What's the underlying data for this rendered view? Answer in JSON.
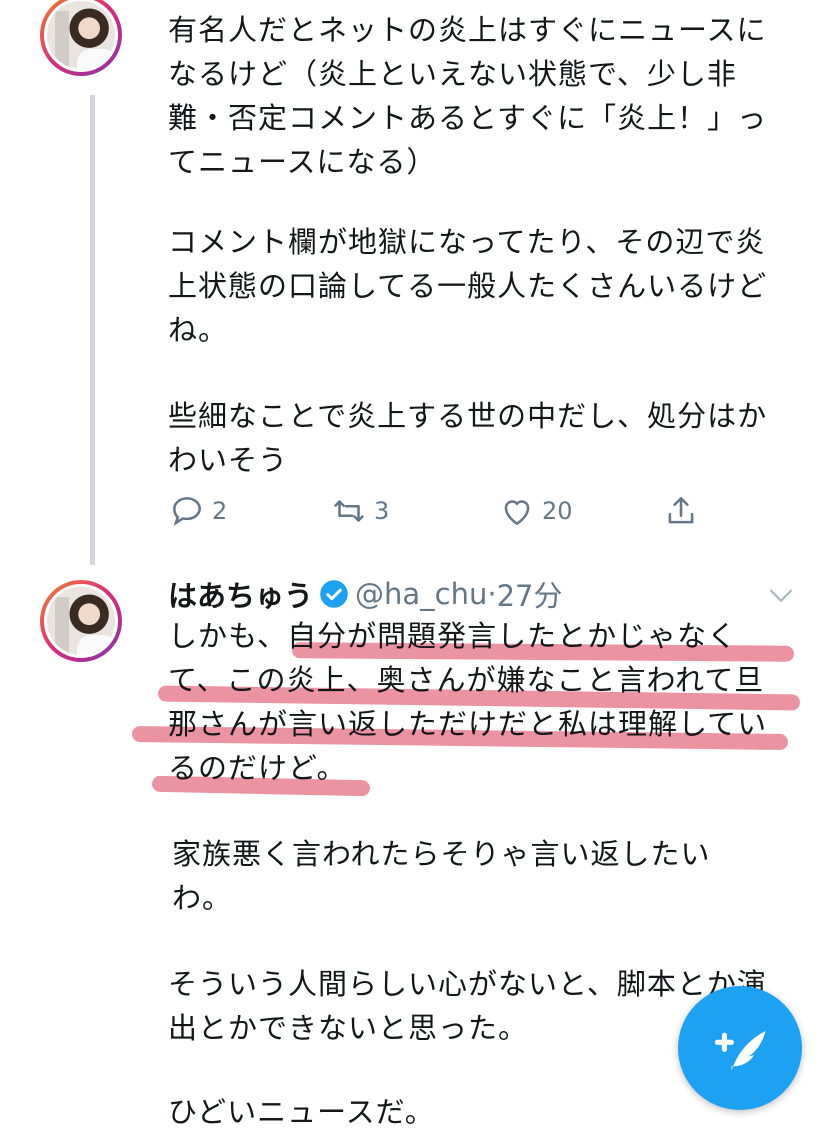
{
  "tweet1": {
    "paragraphs": [
      "有名人だとネットの炎上はすぐにニュースに\nなるけど（炎上といえない状態で、少し非\n難・否定コメントあるとすぐに「炎上！」っ\nてニュースになる）",
      "コメント欄が地獄になってたり、その辺で炎\n上状態の口論してる一般人たくさんいるけど\nね。",
      "些細なことで炎上する世の中だし、処分はか\nわいそう"
    ],
    "actions": {
      "reply_count": "2",
      "retweet_count": "3",
      "like_count": "20"
    }
  },
  "tweet2": {
    "display_name": "はあちゅう",
    "handle": "@ha_chu",
    "separator": "·",
    "time": "27分",
    "paragraphs": [
      "しかも、自分が問題発言したとかじゃなく\nて、この炎上、奥さんが嫌なこと言われて旦\n那さんが言い返しただけだと私は理解してい\nるのだけど。",
      "家族悪く言われたらそりゃ言い返したい\nわ。",
      "そういう人間らしい心がないと、脚本とか演\n出とかできないと思った。",
      "ひどいニュースだ。"
    ]
  },
  "colors": {
    "accent": "#1da1f2",
    "highlight": "#e8808f",
    "muted": "#657786"
  },
  "icons": [
    "reply-icon",
    "retweet-icon",
    "like-icon",
    "share-icon",
    "verified-icon",
    "chevron-down-icon",
    "compose-icon"
  ]
}
